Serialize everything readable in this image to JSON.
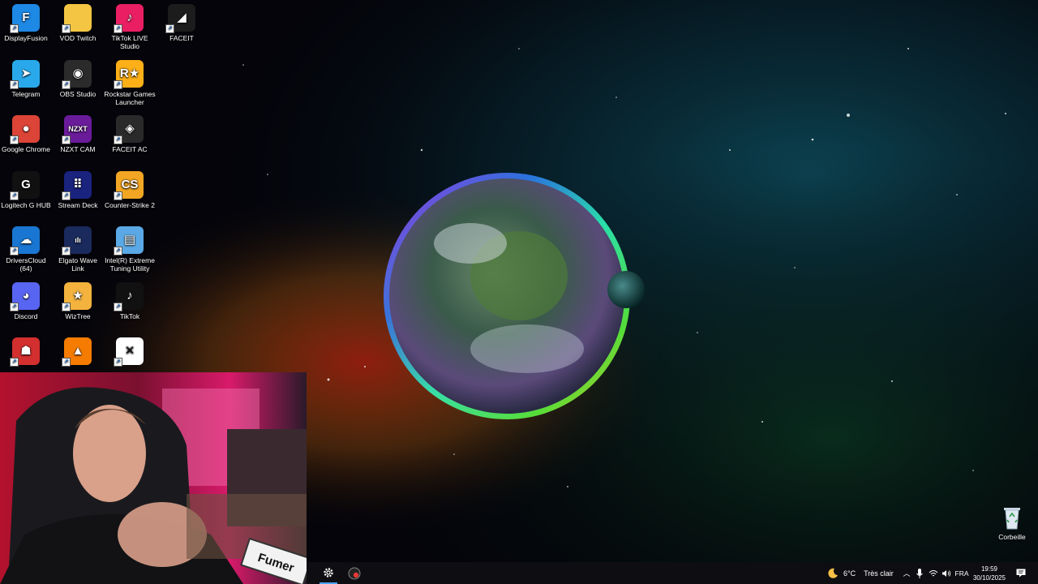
{
  "desktop": {
    "icons": [
      {
        "label": "DisplayFusion",
        "icon": "displayfusion-icon",
        "color": "#1e88e5",
        "glyph": "F"
      },
      {
        "label": "VOD Twitch",
        "icon": "folder-icon",
        "color": "#f4c542",
        "glyph": ""
      },
      {
        "label": "TikTok LIVE Studio",
        "icon": "tiktok-live-studio-icon",
        "color": "#e91e63",
        "glyph": "♪"
      },
      {
        "label": "FACEIT",
        "icon": "faceit-icon",
        "color": "#1c1c1c",
        "glyph": "◢"
      },
      {
        "label": "Telegram",
        "icon": "telegram-icon",
        "color": "#29a9eb",
        "glyph": "➤"
      },
      {
        "label": "OBS Studio",
        "icon": "obs-studio-icon",
        "color": "#2b2b2b",
        "glyph": "◉"
      },
      {
        "label": "Rockstar Games Launcher",
        "icon": "rockstar-icon",
        "color": "#fcaf17",
        "glyph": "R★"
      },
      {
        "label": "Google Chrome",
        "icon": "chrome-icon",
        "color": "#db4437",
        "glyph": "●"
      },
      {
        "label": "NZXT CAM",
        "icon": "nzxt-cam-icon",
        "color": "#6a1b9a",
        "glyph": "NZXT"
      },
      {
        "label": "FACEIT AC",
        "icon": "faceit-ac-icon",
        "color": "#2a2a2a",
        "glyph": "◈"
      },
      {
        "label": "Logitech G HUB",
        "icon": "logitech-ghub-icon",
        "color": "#111111",
        "glyph": "G"
      },
      {
        "label": "Stream Deck",
        "icon": "stream-deck-icon",
        "color": "#1a237e",
        "glyph": "⠿"
      },
      {
        "label": "Counter-Strike 2",
        "icon": "counter-strike-icon",
        "color": "#f2a623",
        "glyph": "CS"
      },
      {
        "label": "DriversCloud (64)",
        "icon": "driverscloud-icon",
        "color": "#1976d2",
        "glyph": "☁"
      },
      {
        "label": "Elgato Wave Link",
        "icon": "elgato-wave-link-icon",
        "color": "#1b2a5c",
        "glyph": "ıIı"
      },
      {
        "label": "Intel(R) Extreme Tuning Utility",
        "icon": "intel-xtu-icon",
        "color": "#5aa9e6",
        "glyph": "▤"
      },
      {
        "label": "Discord",
        "icon": "discord-icon",
        "color": "#5865f2",
        "glyph": "◕"
      },
      {
        "label": "WizTree",
        "icon": "wiztree-icon",
        "color": "#f3b33d",
        "glyph": "★"
      },
      {
        "label": "TikTok",
        "icon": "tiktok-icon",
        "color": "#111111",
        "glyph": "♪"
      },
      {
        "label": "",
        "icon": "red-app-icon",
        "color": "#d32f2f",
        "glyph": "☗"
      },
      {
        "label": "",
        "icon": "vlc-icon",
        "color": "#f57c00",
        "glyph": "▲"
      },
      {
        "label": "",
        "icon": "capcut-icon",
        "color": "#ffffff",
        "glyph": "✕"
      }
    ],
    "recycle_bin": {
      "label": "Corbeille",
      "icon": "recycle-bin-icon"
    }
  },
  "webcam": {
    "sign_text": "Fumer"
  },
  "taskbar": {
    "apps": [
      {
        "icon": "settings-gear-icon"
      },
      {
        "icon": "record-app-icon"
      }
    ],
    "weather": {
      "temp": "6°C",
      "condition": "Très clair",
      "icon": "moon-weather-icon"
    },
    "tray": {
      "chevron_icon": "chevron-up-icon",
      "mic_icon": "microphone-icon",
      "network_icon": "wifi-icon",
      "volume_icon": "speaker-icon",
      "language": "FRA",
      "notification_icon": "notification-icon"
    },
    "clock": {
      "time": "19:59",
      "date": "30/10/2025"
    }
  },
  "colors": {
    "taskbar_bg": "#0e0e12",
    "accent": "#4aa3ff"
  }
}
